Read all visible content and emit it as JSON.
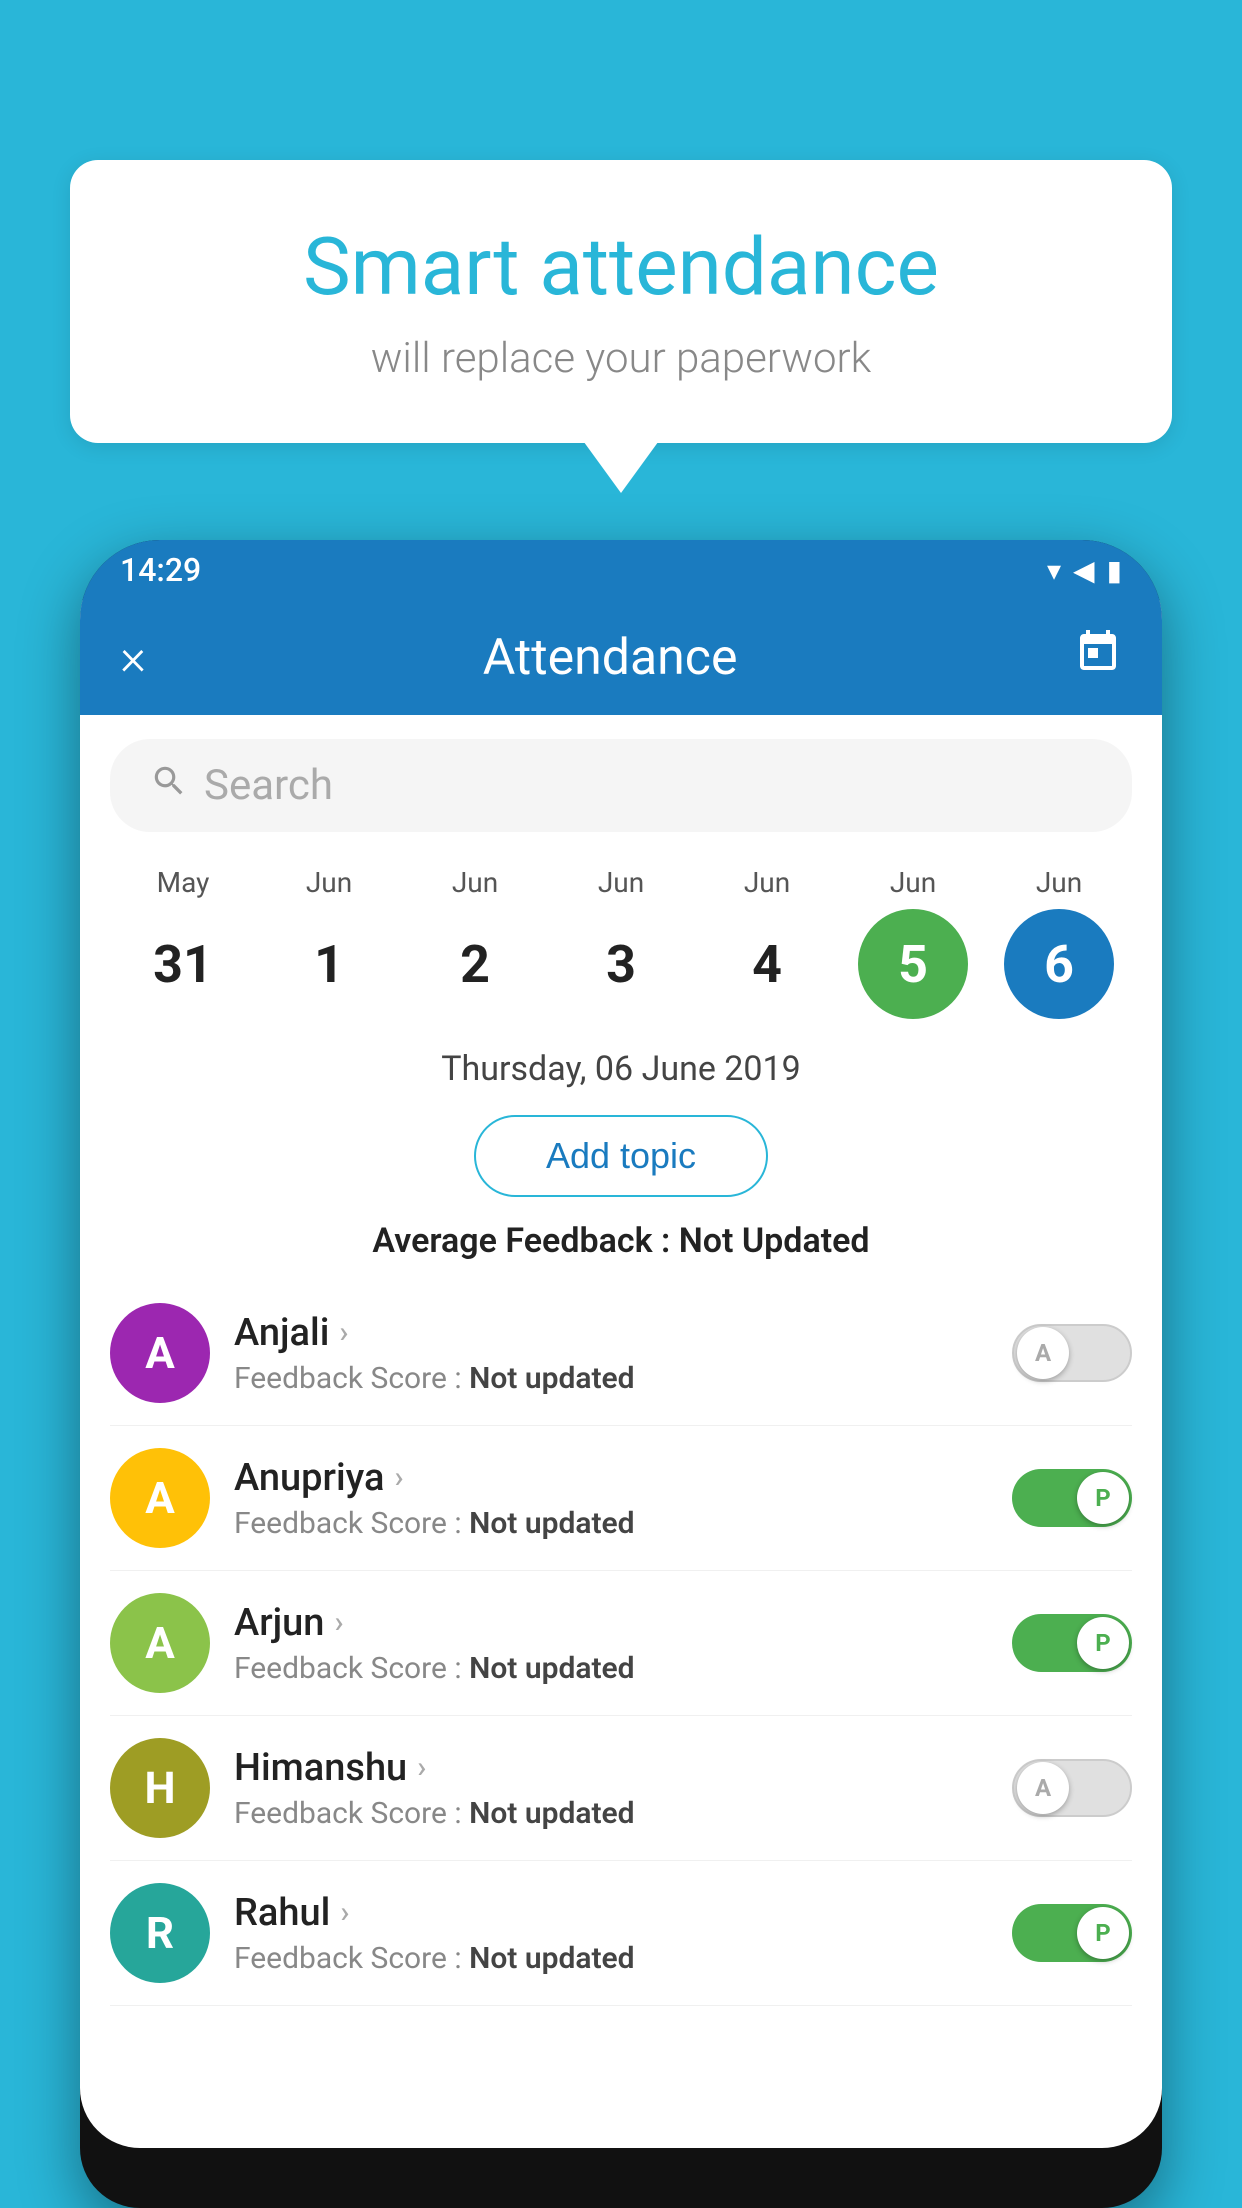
{
  "background_color": "#29B6D8",
  "bubble": {
    "title": "Smart attendance",
    "subtitle": "will replace your paperwork"
  },
  "status_bar": {
    "time": "14:29",
    "signal_icon": "▼◄",
    "battery_icon": "🔋"
  },
  "header": {
    "title": "Attendance",
    "close_label": "×",
    "calendar_icon": "📅"
  },
  "search": {
    "placeholder": "Search"
  },
  "calendar": {
    "days": [
      {
        "month": "May",
        "date": "31",
        "style": "normal"
      },
      {
        "month": "Jun",
        "date": "1",
        "style": "normal"
      },
      {
        "month": "Jun",
        "date": "2",
        "style": "normal"
      },
      {
        "month": "Jun",
        "date": "3",
        "style": "normal"
      },
      {
        "month": "Jun",
        "date": "4",
        "style": "normal"
      },
      {
        "month": "Jun",
        "date": "5",
        "style": "today"
      },
      {
        "month": "Jun",
        "date": "6",
        "style": "selected"
      }
    ]
  },
  "selected_date_label": "Thursday, 06 June 2019",
  "add_topic_label": "Add topic",
  "average_feedback_label": "Average Feedback :",
  "average_feedback_value": "Not Updated",
  "students": [
    {
      "name": "Anjali",
      "avatar_letter": "A",
      "avatar_color": "#9C27B0",
      "feedback_label": "Feedback Score :",
      "feedback_value": "Not updated",
      "toggle": "off",
      "toggle_letter": "A"
    },
    {
      "name": "Anupriya",
      "avatar_letter": "A",
      "avatar_color": "#FFC107",
      "feedback_label": "Feedback Score :",
      "feedback_value": "Not updated",
      "toggle": "on",
      "toggle_letter": "P"
    },
    {
      "name": "Arjun",
      "avatar_letter": "A",
      "avatar_color": "#8BC34A",
      "feedback_label": "Feedback Score :",
      "feedback_value": "Not updated",
      "toggle": "on",
      "toggle_letter": "P"
    },
    {
      "name": "Himanshu",
      "avatar_letter": "H",
      "avatar_color": "#9E9D24",
      "feedback_label": "Feedback Score :",
      "feedback_value": "Not updated",
      "toggle": "off",
      "toggle_letter": "A"
    },
    {
      "name": "Rahul",
      "avatar_letter": "R",
      "avatar_color": "#26A69A",
      "feedback_label": "Feedback Score :",
      "feedback_value": "Not updated",
      "toggle": "on",
      "toggle_letter": "P"
    }
  ]
}
